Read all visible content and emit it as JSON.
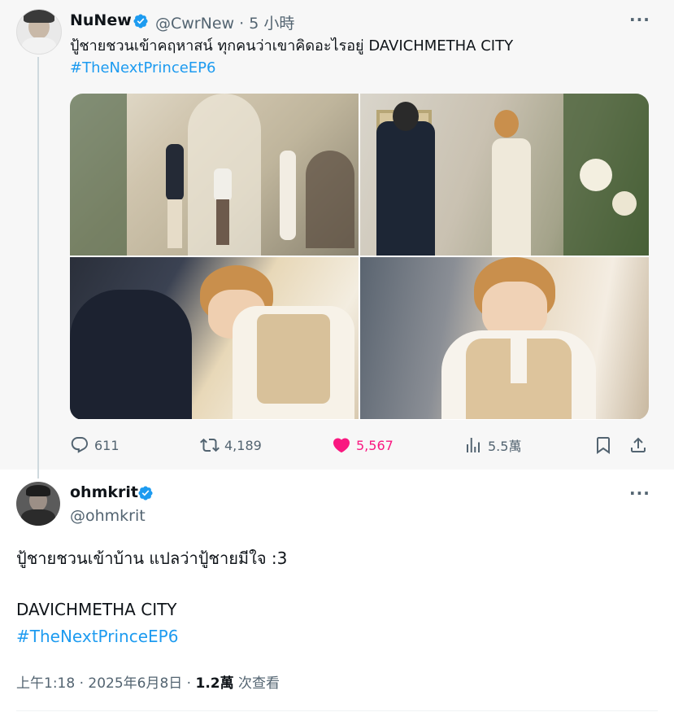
{
  "quoted_post": {
    "author_name": "NuNew",
    "handle": "@CwrNew",
    "separator": "·",
    "time": "5 小時",
    "text_line1": "ปู้ชายชวนเข้าคฤหาสน์ ทุกคนว่าเขาคิดอะไรอยู่ DAVICHMETHA CITY",
    "hashtag": "#TheNextPrinceEP6",
    "more": "···",
    "stats": {
      "replies": "611",
      "reposts": "4,189",
      "likes": "5,567",
      "views": "5.5萬"
    }
  },
  "reply_post": {
    "author_name": "ohmkrit",
    "handle": "@ohmkrit",
    "more": "···",
    "text_line1": "ปู้ชายชวนเข้าบ้าน แปลว่าปู้ชายมีใจ :3",
    "text_line2": "DAVICHMETHA CITY",
    "hashtag": "#TheNextPrinceEP6",
    "timestamp": "上午1:18 · 2025年6月8日 · ",
    "views_count": "1.2萬",
    "views_label": " 次查看"
  },
  "icons": [
    "verified-badge-icon",
    "more-icon",
    "reply-icon",
    "repost-icon",
    "heart-icon",
    "views-icon",
    "bookmark-icon",
    "share-icon"
  ],
  "colors": {
    "accent": "#1d9bf0",
    "like": "#f91880",
    "muted": "#536471"
  }
}
